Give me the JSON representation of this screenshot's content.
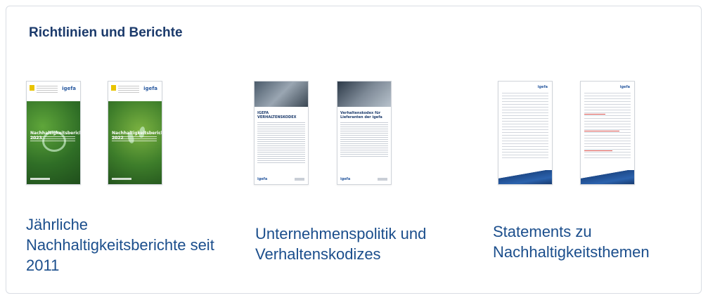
{
  "section": {
    "title": "Richtlinien und Berichte"
  },
  "groups": [
    {
      "caption": "Jährliche Nachhaltigkeitsberichte seit 2011",
      "documents": [
        {
          "cover_title": "Nachhaltigkeitsbericht 2023",
          "logo": "igefa"
        },
        {
          "cover_title": "Nachhaltigkeitsbericht 2022",
          "logo": "igefa"
        }
      ]
    },
    {
      "caption": "Unternehmenspolitik und Verhaltenskodizes",
      "documents": [
        {
          "heading": "IGEFA VERHALTENSKODEX",
          "logo": "igefa"
        },
        {
          "heading": "Verhaltenskodex für Lieferanten der igefa",
          "logo": "igefa"
        }
      ]
    },
    {
      "caption": "Statements zu Nachhaltigkeitsthemen",
      "documents": [
        {
          "logo": "igefa"
        },
        {
          "logo": "igefa"
        }
      ]
    }
  ],
  "colors": {
    "title": "#1b3a6b",
    "caption": "#1b4e8c",
    "border": "#d9dde3"
  }
}
